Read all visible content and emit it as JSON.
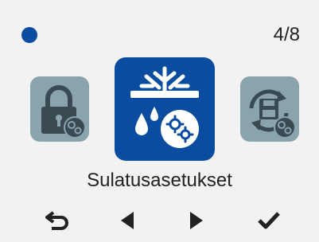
{
  "header": {
    "page_counter": "4/8"
  },
  "carousel": {
    "items": [
      {
        "icon": "lock-settings-icon"
      },
      {
        "icon": "defrost-settings-icon"
      },
      {
        "icon": "backup-restore-settings-icon"
      }
    ],
    "selected_title": "Sulatusasetukset"
  },
  "colors": {
    "accent": "#0a4ca0",
    "inactive_tile": "#8aa3ad",
    "background": "#f2f2f2"
  },
  "nav": {
    "icons": [
      "back-arrow-icon",
      "left-triangle-icon",
      "right-triangle-icon",
      "checkmark-icon"
    ]
  }
}
